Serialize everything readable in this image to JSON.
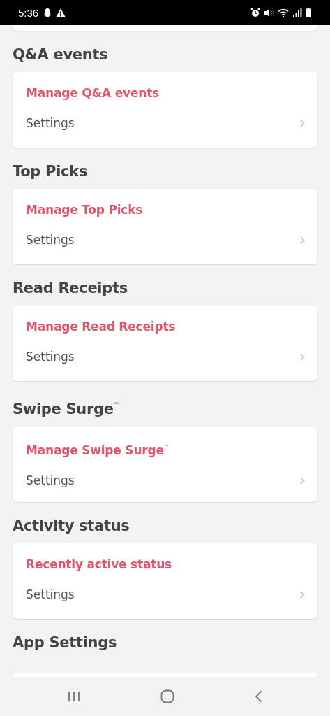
{
  "status_bar": {
    "time": "5:36"
  },
  "sections": [
    {
      "heading": "Q&A events",
      "link": "Manage Q&A events",
      "row_label": "Settings"
    },
    {
      "heading": "Top Picks",
      "link": "Manage Top Picks",
      "row_label": "Settings"
    },
    {
      "heading": "Read Receipts",
      "link": "Manage Read Receipts",
      "row_label": "Settings"
    },
    {
      "heading": "Swipe Surge$^{™}$",
      "link": "Manage Swipe Surge$^{™}$",
      "row_label": "Settings"
    },
    {
      "heading": "Activity status",
      "link": "Recently active status",
      "row_label": "Settings"
    },
    {
      "heading": "App Settings"
    }
  ]
}
